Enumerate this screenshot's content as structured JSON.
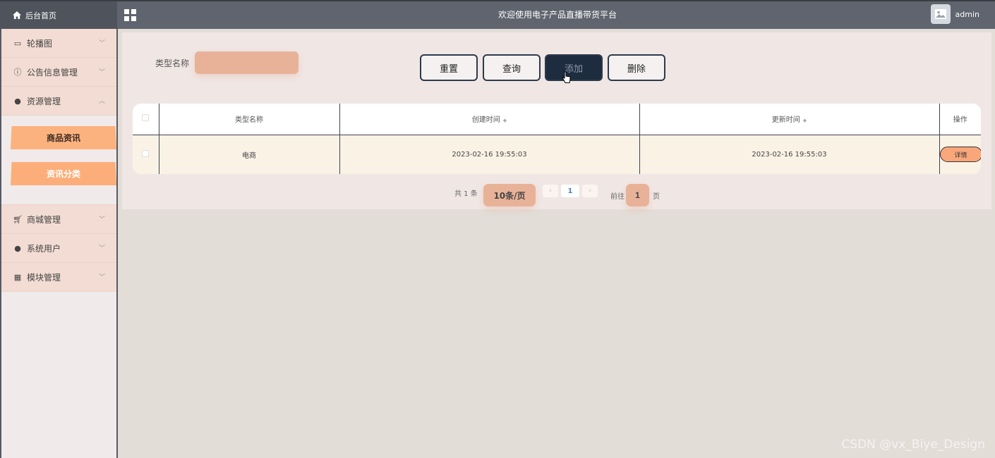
{
  "header": {
    "home_label": "后台首页",
    "site_title": "欢迎使用电子产品直播带货平台",
    "username": "admin"
  },
  "sidebar": {
    "items": [
      {
        "label": "轮播图",
        "icon": "image-icon",
        "expanded": false
      },
      {
        "label": "公告信息管理",
        "icon": "info-circle-icon",
        "expanded": false
      },
      {
        "label": "资源管理",
        "icon": "location-pin-icon",
        "expanded": true
      },
      {
        "label": "商城管理",
        "icon": "cart-icon",
        "expanded": false
      },
      {
        "label": "系统用户",
        "icon": "user-icon",
        "expanded": false
      },
      {
        "label": "模块管理",
        "icon": "grid-icon",
        "expanded": false
      }
    ],
    "submenu": [
      {
        "label": "商品资讯"
      },
      {
        "label": "资讯分类"
      }
    ]
  },
  "filter": {
    "label": "类型名称",
    "value": "",
    "placeholder": ""
  },
  "buttons": {
    "reset": "重置",
    "query": "查询",
    "add": "添加",
    "delete": "删除"
  },
  "table": {
    "columns": [
      "类型名称",
      "创建时间",
      "更新时间",
      "操作"
    ],
    "rows": [
      {
        "name": "电商",
        "created": "2023-02-16 19:55:03",
        "updated": "2023-02-16 19:55:03",
        "action": "详情"
      }
    ]
  },
  "pagination": {
    "total_text": "共 1 条",
    "page_size": "10条/页",
    "current_page": "1",
    "goto_label": "前往",
    "goto_value": "1",
    "page_suffix": "页"
  },
  "watermark": "CSDN @vx_Biye_Design",
  "colors": {
    "topbar": "#5f646e",
    "accent_peach": "#fbb27f",
    "primary_navy": "#1e2c3f"
  }
}
